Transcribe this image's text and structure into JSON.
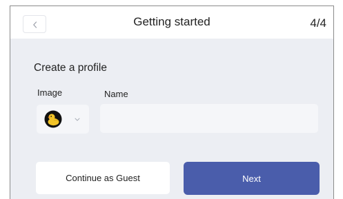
{
  "header": {
    "title": "Getting started",
    "step": "4/4",
    "back_icon": "chevron-left-icon"
  },
  "profile": {
    "section_title": "Create a profile",
    "image_label": "Image",
    "name_label": "Name",
    "avatar_icon": "duck-avatar-icon",
    "dropdown_icon": "chevron-down-icon",
    "name_value": "",
    "name_placeholder": ""
  },
  "actions": {
    "guest_label": "Continue as Guest",
    "next_label": "Next"
  },
  "colors": {
    "accent": "#4a5dab",
    "background": "#eceef3",
    "avatar_body": "#f2c428",
    "avatar_beak": "#f08a24",
    "avatar_circle": "#111111"
  }
}
